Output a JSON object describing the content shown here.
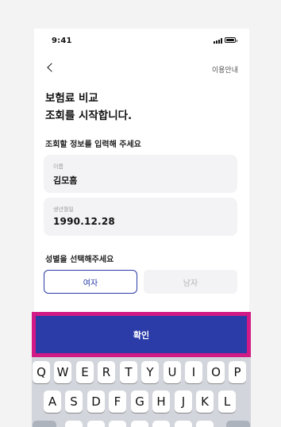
{
  "status_bar": {
    "time": "9:41"
  },
  "nav": {
    "help_label": "이용안내"
  },
  "header": {
    "title_line1": "보험료 비교",
    "title_line2": "조회를 시작합니다."
  },
  "info_section": {
    "label": "조회할 정보를 입력해 주세요"
  },
  "name_field": {
    "caption": "이름",
    "value": "김모흠"
  },
  "birth_field": {
    "caption": "생년월일",
    "value": "1990.12.28"
  },
  "gender_section": {
    "label": "성별을 선택해주세요",
    "options": [
      "여자",
      "남자"
    ],
    "selected": "여자"
  },
  "confirm_button": {
    "label": "확인"
  },
  "keyboard": {
    "row1": [
      "Q",
      "W",
      "E",
      "R",
      "T",
      "Y",
      "U",
      "I",
      "O",
      "P"
    ],
    "row2": [
      "A",
      "S",
      "D",
      "F",
      "G",
      "H",
      "J",
      "K",
      "L"
    ]
  },
  "colors": {
    "accent": "#2b3ca8",
    "highlight_frame": "#d21a86",
    "field_bg": "#f3f3f5"
  }
}
